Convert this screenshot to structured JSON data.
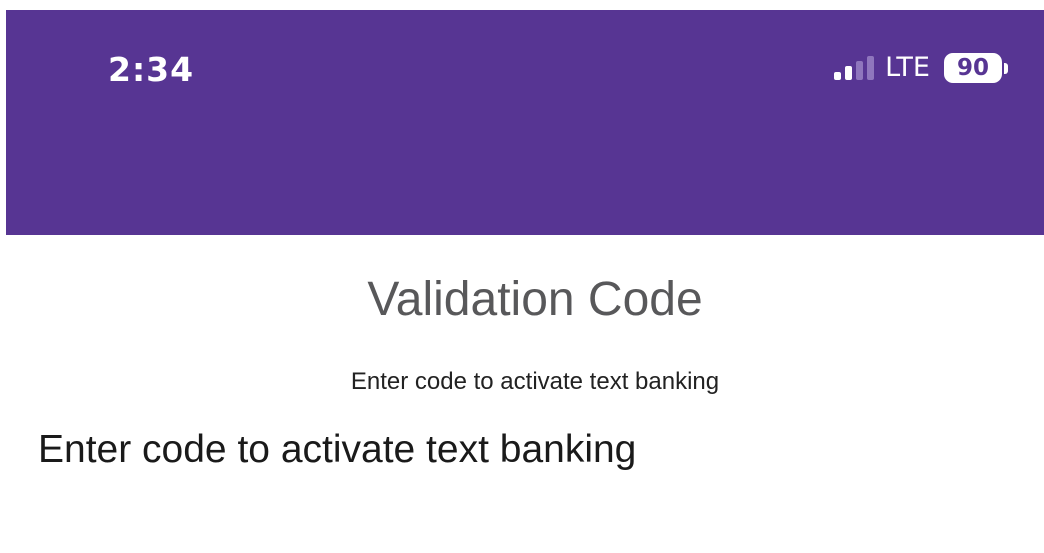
{
  "status_bar": {
    "time": "2:34",
    "network": "LTE",
    "battery_level": "90",
    "signal_bars_total": 4,
    "signal_bars_active": 2,
    "background_color": "#573593"
  },
  "page": {
    "title": "Validation Code",
    "subtitle": "Enter code to activate text banking",
    "field_label": "Enter code to activate text banking"
  }
}
